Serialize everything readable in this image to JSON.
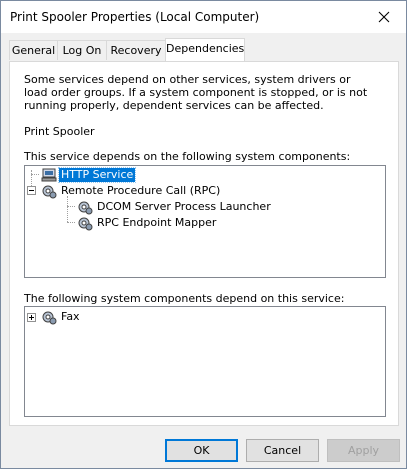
{
  "window": {
    "title": "Print Spooler Properties (Local Computer)"
  },
  "tabs": [
    {
      "label": "General"
    },
    {
      "label": "Log On"
    },
    {
      "label": "Recovery"
    },
    {
      "label": "Dependencies",
      "active": true
    }
  ],
  "dependencies": {
    "description": "Some services depend on other services, system drivers or load order groups. If a system component is stopped, or is not running properly, dependent services can be affected.",
    "service_name": "Print Spooler",
    "depends_on_label": "This service depends on the following system components:",
    "depends_on_tree": [
      {
        "label": "HTTP Service",
        "icon": "driver-icon",
        "selected": true
      },
      {
        "label": "Remote Procedure Call (RPC)",
        "icon": "gear-service-icon",
        "expanded": true,
        "children": [
          {
            "label": "DCOM Server Process Launcher",
            "icon": "gear-service-icon"
          },
          {
            "label": "RPC Endpoint Mapper",
            "icon": "gear-service-icon"
          }
        ]
      }
    ],
    "dependents_label": "The following system components depend on this service:",
    "dependents_tree": [
      {
        "label": "Fax",
        "icon": "gear-service-icon",
        "expanded": false
      }
    ]
  },
  "buttons": {
    "ok": "OK",
    "cancel": "Cancel",
    "apply": "Apply"
  },
  "colors": {
    "selection": "#0078d7",
    "dialog_bg": "#f0f0f0",
    "accent_border": "#0078d7"
  }
}
